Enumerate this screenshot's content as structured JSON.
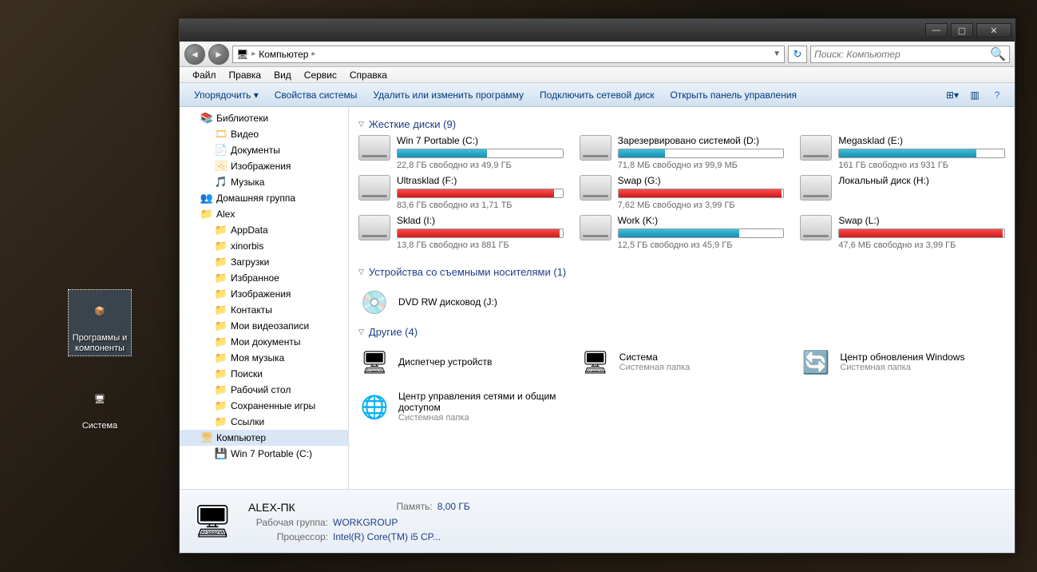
{
  "desktop": {
    "icons": [
      {
        "label": "Программы\nи\nкомпоненты"
      },
      {
        "label": "Система"
      }
    ]
  },
  "titlebar": {
    "min": "—",
    "max": "▢",
    "close": "✕"
  },
  "nav": {
    "breadcrumb_root": "Компьютер",
    "search_placeholder": "Поиск: Компьютер"
  },
  "menu": [
    "Файл",
    "Правка",
    "Вид",
    "Сервис",
    "Справка"
  ],
  "toolbar": {
    "organize": "Упорядочить ▾",
    "items": [
      "Свойства системы",
      "Удалить или изменить программу",
      "Подключить сетевой диск",
      "Открыть панель управления"
    ]
  },
  "sidebar": [
    {
      "label": "Библиотеки",
      "indent": 1,
      "icon": "📚"
    },
    {
      "label": "Видео",
      "indent": 2,
      "icon": "🎞"
    },
    {
      "label": "Документы",
      "indent": 2,
      "icon": "📄"
    },
    {
      "label": "Изображения",
      "indent": 2,
      "icon": "🖼"
    },
    {
      "label": "Музыка",
      "indent": 2,
      "icon": "🎵"
    },
    {
      "label": "Домашняя группа",
      "indent": 1,
      "icon": "👥"
    },
    {
      "label": "Alex",
      "indent": 1,
      "icon": "📁"
    },
    {
      "label": "AppData",
      "indent": 2,
      "icon": "📁"
    },
    {
      "label": "xinorbis",
      "indent": 2,
      "icon": "📁"
    },
    {
      "label": "Загрузки",
      "indent": 2,
      "icon": "📁"
    },
    {
      "label": "Избранное",
      "indent": 2,
      "icon": "📁"
    },
    {
      "label": "Изображения",
      "indent": 2,
      "icon": "📁"
    },
    {
      "label": "Контакты",
      "indent": 2,
      "icon": "📁"
    },
    {
      "label": "Мои видеозаписи",
      "indent": 2,
      "icon": "📁"
    },
    {
      "label": "Мои документы",
      "indent": 2,
      "icon": "📁"
    },
    {
      "label": "Моя музыка",
      "indent": 2,
      "icon": "📁"
    },
    {
      "label": "Поиски",
      "indent": 2,
      "icon": "📁"
    },
    {
      "label": "Рабочий стол",
      "indent": 2,
      "icon": "📁"
    },
    {
      "label": "Сохраненные игры",
      "indent": 2,
      "icon": "📁"
    },
    {
      "label": "Ссылки",
      "indent": 2,
      "icon": "📁"
    },
    {
      "label": "Компьютер",
      "indent": 1,
      "icon": "🖥",
      "selected": true
    },
    {
      "label": "Win 7 Portable (C:)",
      "indent": 2,
      "icon": "💾"
    }
  ],
  "groups": {
    "hdd_title": "Жесткие диски (9)",
    "removable_title": "Устройства со съемными носителями (1)",
    "other_title": "Другие (4)"
  },
  "drives": [
    {
      "name": "Win 7 Portable (C:)",
      "free": "22,8 ГБ свободно из 49,9 ГБ",
      "pct": 54,
      "color": "blue"
    },
    {
      "name": "Зарезервировано системой (D:)",
      "free": "71,8 МБ свободно из 99,9 МБ",
      "pct": 28,
      "color": "blue"
    },
    {
      "name": "Megasklad (E:)",
      "free": "161 ГБ свободно из 931 ГБ",
      "pct": 83,
      "color": "blue"
    },
    {
      "name": "Ultrasklad (F:)",
      "free": "83,6 ГБ свободно из 1,71 ТБ",
      "pct": 95,
      "color": "red"
    },
    {
      "name": "Swap (G:)",
      "free": "7,62 МБ свободно из 3,99 ГБ",
      "pct": 99,
      "color": "red"
    },
    {
      "name": "Локальный диск (H:)",
      "free": "",
      "pct": 0,
      "color": "blue"
    },
    {
      "name": "Sklad (I:)",
      "free": "13,8 ГБ свободно из 881 ГБ",
      "pct": 98,
      "color": "red"
    },
    {
      "name": "Work (K:)",
      "free": "12,5 ГБ свободно из 45,9 ГБ",
      "pct": 73,
      "color": "blue"
    },
    {
      "name": "Swap (L:)",
      "free": "47,6 МБ свободно из 3,99 ГБ",
      "pct": 99,
      "color": "red"
    }
  ],
  "dvd": {
    "name": "DVD RW дисковод (J:)"
  },
  "other": [
    {
      "name": "Диспетчер устройств",
      "sub": ""
    },
    {
      "name": "Система",
      "sub": "Системная папка"
    },
    {
      "name": "Центр обновления Windows",
      "sub": "Системная папка"
    },
    {
      "name": "Центр управления сетями и общим доступом",
      "sub": "Системная папка"
    }
  ],
  "details": {
    "pc_name": "ALEX-ПК",
    "mem_label": "Память:",
    "mem_value": "8,00 ГБ",
    "wg_label": "Рабочая группа:",
    "wg_value": "WORKGROUP",
    "cpu_label": "Процессор:",
    "cpu_value": "Intel(R) Core(TM) i5 CP..."
  }
}
